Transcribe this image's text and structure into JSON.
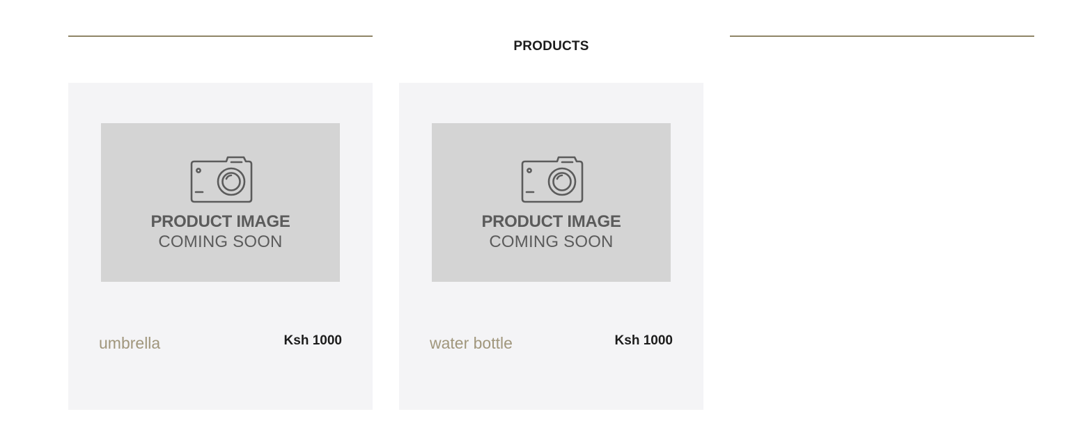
{
  "section": {
    "title": "PRODUCTS"
  },
  "placeholder": {
    "line1": "PRODUCT IMAGE",
    "line2": "COMING SOON"
  },
  "products": [
    {
      "name": "umbrella",
      "price": "Ksh 1000",
      "icon": "camera-icon"
    },
    {
      "name": "water bottle",
      "price": "Ksh 1000",
      "icon": "camera-icon"
    }
  ],
  "colors": {
    "accent_rule": "#8f8566",
    "product_name": "#a0967c",
    "card_background": "#f4f4f6",
    "image_placeholder": "#d4d4d4",
    "placeholder_text": "#5b5b5b"
  }
}
